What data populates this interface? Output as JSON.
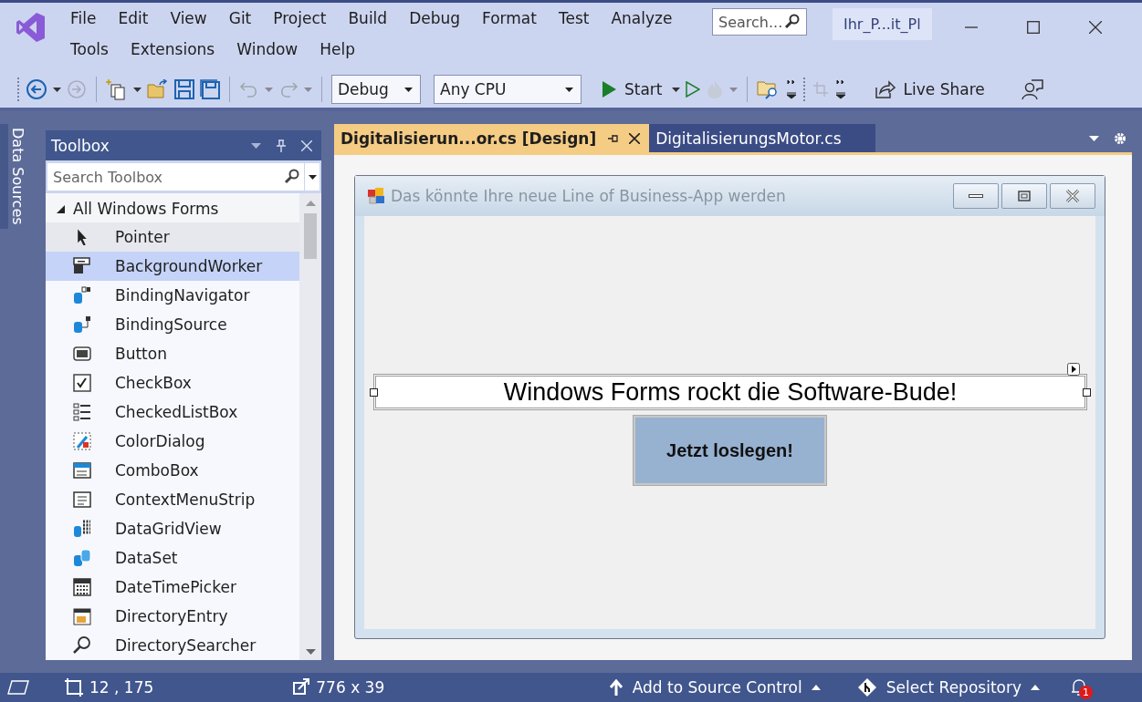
{
  "window": {
    "title": "Ihr_P...it_Pl"
  },
  "menu": [
    {
      "label": "File"
    },
    {
      "label": "Edit"
    },
    {
      "label": "View"
    },
    {
      "label": "Git"
    },
    {
      "label": "Project"
    },
    {
      "label": "Build"
    },
    {
      "label": "Debug"
    },
    {
      "label": "Format"
    },
    {
      "label": "Test"
    },
    {
      "label": "Analyze"
    },
    {
      "label": "Tools"
    },
    {
      "label": "Extensions"
    },
    {
      "label": "Window"
    },
    {
      "label": "Help"
    }
  ],
  "search": {
    "placeholder": "Search..."
  },
  "toolbar": {
    "configuration": "Debug",
    "platform": "Any CPU",
    "start": "Start",
    "live_share": "Live Share"
  },
  "side_tabs": [
    {
      "label": "Data Sources"
    }
  ],
  "toolbox": {
    "title": "Toolbox",
    "search_placeholder": "Search Toolbox",
    "group": {
      "label": "All Windows Forms",
      "expanded": true
    },
    "items": [
      {
        "label": "Pointer",
        "kind": "pointer",
        "selected": false,
        "highlighted": true
      },
      {
        "label": "BackgroundWorker",
        "kind": "worker",
        "selected": true,
        "highlighted": false
      },
      {
        "label": "BindingNavigator",
        "kind": "navigator",
        "selected": false,
        "highlighted": false
      },
      {
        "label": "BindingSource",
        "kind": "source",
        "selected": false,
        "highlighted": false
      },
      {
        "label": "Button",
        "kind": "button",
        "selected": false,
        "highlighted": false
      },
      {
        "label": "CheckBox",
        "kind": "checkbox",
        "selected": false,
        "highlighted": false
      },
      {
        "label": "CheckedListBox",
        "kind": "list",
        "selected": false,
        "highlighted": false
      },
      {
        "label": "ColorDialog",
        "kind": "color",
        "selected": false,
        "highlighted": false
      },
      {
        "label": "ComboBox",
        "kind": "combo",
        "selected": false,
        "highlighted": false
      },
      {
        "label": "ContextMenuStrip",
        "kind": "menu",
        "selected": false,
        "highlighted": false
      },
      {
        "label": "DataGridView",
        "kind": "grid",
        "selected": false,
        "highlighted": false
      },
      {
        "label": "DataSet",
        "kind": "dataset",
        "selected": false,
        "highlighted": false
      },
      {
        "label": "DateTimePicker",
        "kind": "calendar",
        "selected": false,
        "highlighted": false
      },
      {
        "label": "DirectoryEntry",
        "kind": "entry",
        "selected": false,
        "highlighted": false
      },
      {
        "label": "DirectorySearcher",
        "kind": "searcher",
        "selected": false,
        "highlighted": false
      }
    ]
  },
  "document_tabs": [
    {
      "label": "Digitalisierun...or.cs [Design]",
      "selected": true
    },
    {
      "label": "DigitalisierungsMotor.cs",
      "selected": false
    }
  ],
  "designer": {
    "form_title": "Das könnte Ihre neue Line of Business-App werden",
    "label": "Windows Forms rockt die Software-Bude!",
    "button": "Jetzt loslegen!"
  },
  "status_bar": {
    "position": "12 , 175",
    "size": "776 x 39",
    "source_control": "Add to Source Control",
    "repository": "Select Repository",
    "notifications": "1"
  }
}
